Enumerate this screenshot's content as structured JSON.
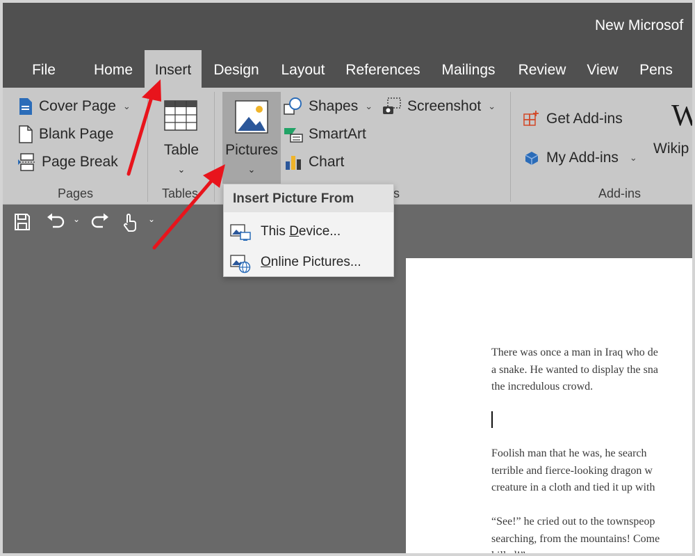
{
  "window": {
    "title": "New Microsof"
  },
  "tabs": [
    {
      "label": "File"
    },
    {
      "label": "Home"
    },
    {
      "label": "Insert"
    },
    {
      "label": "Design"
    },
    {
      "label": "Layout"
    },
    {
      "label": "References"
    },
    {
      "label": "Mailings"
    },
    {
      "label": "Review"
    },
    {
      "label": "View"
    },
    {
      "label": "Pens"
    }
  ],
  "ribbon": {
    "pages": {
      "cover_page": "Cover Page",
      "blank_page": "Blank Page",
      "page_break": "Page Break",
      "group_label": "Pages"
    },
    "tables": {
      "table": "Table",
      "group_label": "Tables"
    },
    "illustrations": {
      "pictures": "Pictures",
      "shapes": "Shapes",
      "smartart": "SmartArt",
      "chart": "Chart",
      "screenshot": "Screenshot",
      "group_label_tail": "s"
    },
    "addins": {
      "get_addins": "Get Add-ins",
      "my_addins": "My Add-ins",
      "wikipedia": "Wikip",
      "group_label": "Add-ins"
    }
  },
  "picture_menu": {
    "header": "Insert Picture From",
    "this_device_pre": "This ",
    "this_device_u": "D",
    "this_device_post": "evice...",
    "online_u": "O",
    "online_post": "nline Pictures..."
  },
  "document": {
    "p1": [
      "There was once a man in Iraq who de",
      "a snake. He wanted to display the sna",
      "the incredulous crowd."
    ],
    "p2": [
      "Foolish man that he was, he search",
      "terrible and fierce-looking dragon w",
      "creature in a cloth and tied it up with"
    ],
    "p3": [
      "“See!” he cried out to the townspeop",
      "searching, from the mountains! Come",
      "killed!”"
    ]
  },
  "colors": {
    "title_bar": "#505050",
    "ribbon": "#c8c8c8",
    "workspace": "#696969",
    "annotation_arrow": "#e8141c"
  }
}
